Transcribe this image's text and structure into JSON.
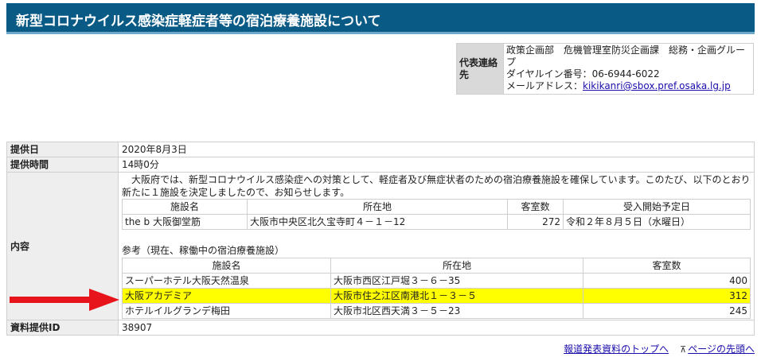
{
  "header": {
    "title": "新型コロナウイルス感染症軽症者等の宿泊療養施設について"
  },
  "contact": {
    "label": "代表連絡先",
    "department": "政策企画部　危機管理室防災企画課　総務・企画グループ",
    "phone": "ダイヤルイン番号：06-6944-6022",
    "email_label": "メールアドレス：",
    "email": "kikikanri@sbox.pref.osaka.lg.jp"
  },
  "info": {
    "date_label": "提供日",
    "date": "2020年8月3日",
    "time_label": "提供時間",
    "time": "14時0分",
    "content_label": "内容",
    "intro": "　大阪府では、新型コロナウイルス感染症への対策として、軽症者及び無症状者のための宿泊療養施設を確保しています。このたび、以下のとおり新たに１施設を決定しましたので、お知らせします。",
    "new_table": {
      "headers": [
        "施設名",
        "所在地",
        "客室数",
        "受入開始予定日"
      ],
      "rows": [
        {
          "name": "the b 大阪御堂筋",
          "address": "大阪市中央区北久宝寺町４－１－12",
          "rooms": "272",
          "start": "令和２年８月５日（水曜日）"
        }
      ]
    },
    "ref_title": "参考（現在、稼働中の宿泊療養施設）",
    "ref_table": {
      "headers": [
        "施設名",
        "所在地",
        "客室数"
      ],
      "rows": [
        {
          "name": "スーパーホテル大阪天然温泉",
          "address": "大阪市西区江戸堀３－６－35",
          "rooms": "400"
        },
        {
          "name": "大阪アカデミア",
          "address": "大阪市住之江区南港北１－３－５",
          "rooms": "312"
        },
        {
          "name": "ホテルイルグランデ梅田",
          "address": "大阪市北区西天満３－５－23",
          "rooms": "245"
        }
      ]
    },
    "id_label": "資料提供ID",
    "id": "38907"
  },
  "footer": {
    "top_link": "報道発表資料のトップへ",
    "page_top_link": "ページの先頭へ"
  },
  "colors": {
    "header_bg": "#0a5a86",
    "highlight": "#ffff00",
    "arrow": "#e8141c"
  }
}
